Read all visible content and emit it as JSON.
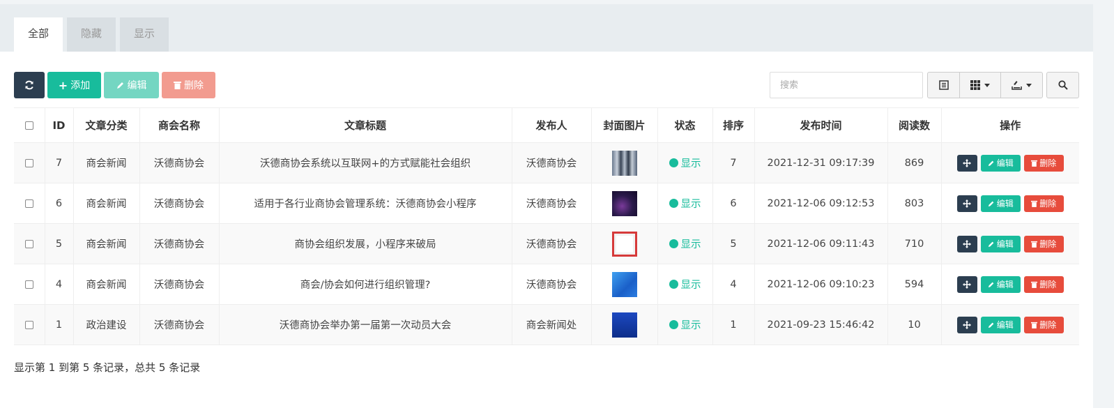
{
  "tabs": [
    {
      "label": "全部",
      "active": true
    },
    {
      "label": "隐藏",
      "active": false
    },
    {
      "label": "显示",
      "active": false
    }
  ],
  "toolbar": {
    "refresh_icon": "refresh-icon",
    "add_label": "添加",
    "edit_label": "编辑",
    "delete_label": "删除"
  },
  "search": {
    "placeholder": "搜索"
  },
  "table": {
    "columns": [
      "ID",
      "文章分类",
      "商会名称",
      "文章标题",
      "发布人",
      "封面图片",
      "状态",
      "排序",
      "发布时间",
      "阅读数",
      "操作"
    ],
    "rows": [
      {
        "id": "7",
        "category": "商会新闻",
        "chamber": "沃德商协会",
        "title": "沃德商协会系统以互联网+的方式赋能社会组织",
        "publisher": "沃德商协会",
        "cover": "cover-people-image",
        "status": "显示",
        "sort": "7",
        "time": "2021-12-31 09:17:39",
        "reads": "869"
      },
      {
        "id": "6",
        "category": "商会新闻",
        "chamber": "沃德商协会",
        "title": "适用于各行业商协会管理系统：沃德商协会小程序",
        "publisher": "沃德商协会",
        "cover": "cover-dark-image",
        "status": "显示",
        "sort": "6",
        "time": "2021-12-06 09:12:53",
        "reads": "803"
      },
      {
        "id": "5",
        "category": "商会新闻",
        "chamber": "沃德商协会",
        "title": "商协会组织发展，小程序来破局",
        "publisher": "沃德商协会",
        "cover": "cover-red-image",
        "status": "显示",
        "sort": "5",
        "time": "2021-12-06 09:11:43",
        "reads": "710"
      },
      {
        "id": "4",
        "category": "商会新闻",
        "chamber": "沃德商协会",
        "title": "商会/协会如何进行组织管理?",
        "publisher": "沃德商协会",
        "cover": "cover-blue-image",
        "status": "显示",
        "sort": "4",
        "time": "2021-12-06 09:10:23",
        "reads": "594"
      },
      {
        "id": "1",
        "category": "政治建设",
        "chamber": "沃德商协会",
        "title": "沃德商协会举办第一届第一次动员大会",
        "publisher": "商会新闻处",
        "cover": "cover-navy-image",
        "status": "显示",
        "sort": "1",
        "time": "2021-09-23 15:46:42",
        "reads": "10"
      }
    ],
    "row_actions": {
      "edit_label": "编辑",
      "delete_label": "删除"
    }
  },
  "summary": "显示第 1 到第 5 条记录，总共 5 条记录",
  "colors": {
    "primary": "#18bc9c",
    "dark": "#2c3e50",
    "danger": "#e74c3c"
  }
}
